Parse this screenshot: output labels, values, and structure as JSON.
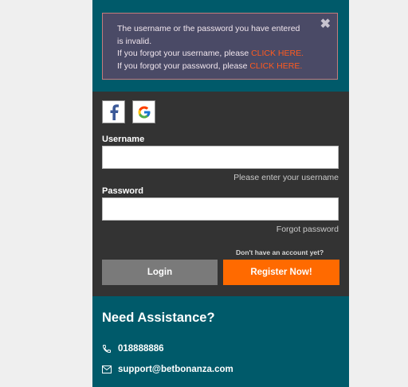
{
  "error": {
    "line1": "The username or the password you have entered",
    "line2": "is invalid.",
    "line3_prefix": "If you forgot your username, please ",
    "line3_link": "CLICK HERE.",
    "line4_prefix": "If you forgot your password, please ",
    "line4_link": "CLICK HERE.",
    "close_icon": "close-x-icon"
  },
  "social": {
    "facebook_icon": "facebook-icon",
    "google_icon": "google-icon"
  },
  "form": {
    "username_label": "Username",
    "username_value": "",
    "username_hint": "Please enter your username",
    "password_label": "Password",
    "password_value": "",
    "forgot_password": "Forgot password",
    "signup_question": "Don't have an account yet?",
    "login_label": "Login",
    "register_label": "Register Now!"
  },
  "assistance": {
    "title": "Need Assistance?",
    "phone": "018888886",
    "email": "support@betbonanza.com"
  },
  "colors": {
    "teal": "#005a6a",
    "dark": "#333333",
    "orange": "#ff6a00",
    "error_bg": "#4a4a66"
  }
}
